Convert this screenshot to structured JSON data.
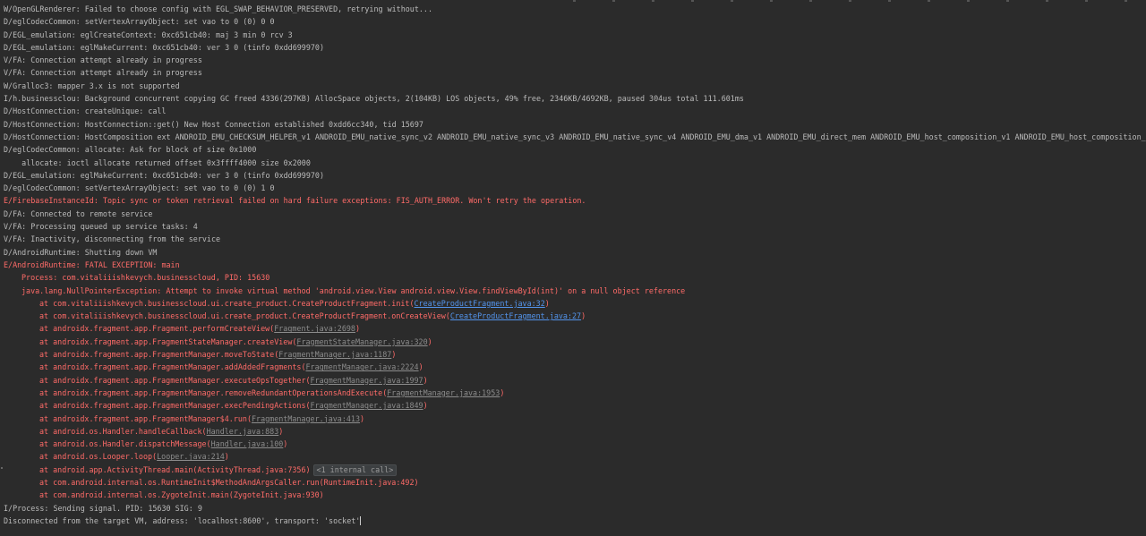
{
  "log": {
    "l01": "W/OpenGLRenderer: Failed to choose config with EGL_SWAP_BEHAVIOR_PRESERVED, retrying without...",
    "l02": "D/eglCodecCommon: setVertexArrayObject: set vao to 0 (0) 0 0",
    "l03": "D/EGL_emulation: eglCreateContext: 0xc651cb40: maj 3 min 0 rcv 3",
    "l04": "D/EGL_emulation: eglMakeCurrent: 0xc651cb40: ver 3 0 (tinfo 0xdd699970)",
    "l05": "V/FA: Connection attempt already in progress",
    "l06": "V/FA: Connection attempt already in progress",
    "l07": "W/Gralloc3: mapper 3.x is not supported",
    "l08": "I/h.businessclou: Background concurrent copying GC freed 4336(297KB) AllocSpace objects, 2(104KB) LOS objects, 49% free, 2346KB/4692KB, paused 304us total 111.601ms",
    "l09": "D/HostConnection: createUnique: call",
    "l10": "D/HostConnection: HostConnection::get() New Host Connection established 0xdd6cc340, tid 15697",
    "l11": "D/HostConnection: HostComposition ext ANDROID_EMU_CHECKSUM_HELPER_v1 ANDROID_EMU_native_sync_v2 ANDROID_EMU_native_sync_v3 ANDROID_EMU_native_sync_v4 ANDROID_EMU_dma_v1 ANDROID_EMU_direct_mem ANDROID_EMU_host_composition_v1 ANDROID_EMU_host_composition_v2",
    "l12": "D/eglCodecCommon: allocate: Ask for block of size 0x1000",
    "l13": "    allocate: ioctl allocate returned offset 0x3ffff4000 size 0x2000",
    "l14": "D/EGL_emulation: eglMakeCurrent: 0xc651cb40: ver 3 0 (tinfo 0xdd699970)",
    "l15": "D/eglCodecCommon: setVertexArrayObject: set vao to 0 (0) 1 0",
    "l16": "E/FirebaseInstanceId: Topic sync or token retrieval failed on hard failure exceptions: FIS_AUTH_ERROR. Won't retry the operation.",
    "l17": "D/FA: Connected to remote service",
    "l18": "V/FA: Processing queued up service tasks: 4",
    "l19": "V/FA: Inactivity, disconnecting from the service",
    "l20": "D/AndroidRuntime: Shutting down VM",
    "l21": "E/AndroidRuntime: FATAL EXCEPTION: main",
    "l22": "Process: com.vitaliiishkevych.businesscloud, PID: 15630",
    "l23": "java.lang.NullPointerException: Attempt to invoke virtual method 'android.view.View android.view.View.findViewById(int)' on a null object reference"
  },
  "trace": [
    {
      "pre": "at com.vitaliiishkevych.businesscloud.ui.create_product.CreateProductFragment.init(",
      "link": "CreateProductFragment.java:32",
      "kind": "link",
      "post": ")"
    },
    {
      "pre": "at com.vitaliiishkevych.businesscloud.ui.create_product.CreateProductFragment.onCreateView(",
      "link": "CreateProductFragment.java:27",
      "kind": "link",
      "post": ")"
    },
    {
      "pre": "at androidx.fragment.app.Fragment.performCreateView(",
      "link": "Fragment.java:2698",
      "kind": "muted",
      "post": ")"
    },
    {
      "pre": "at androidx.fragment.app.FragmentStateManager.createView(",
      "link": "FragmentStateManager.java:320",
      "kind": "muted",
      "post": ")"
    },
    {
      "pre": "at androidx.fragment.app.FragmentManager.moveToState(",
      "link": "FragmentManager.java:1187",
      "kind": "muted",
      "post": ")"
    },
    {
      "pre": "at androidx.fragment.app.FragmentManager.addAddedFragments(",
      "link": "FragmentManager.java:2224",
      "kind": "muted",
      "post": ")"
    },
    {
      "pre": "at androidx.fragment.app.FragmentManager.executeOpsTogether(",
      "link": "FragmentManager.java:1997",
      "kind": "muted",
      "post": ")"
    },
    {
      "pre": "at androidx.fragment.app.FragmentManager.removeRedundantOperationsAndExecute(",
      "link": "FragmentManager.java:1953",
      "kind": "muted",
      "post": ")"
    },
    {
      "pre": "at androidx.fragment.app.FragmentManager.execPendingActions(",
      "link": "FragmentManager.java:1849",
      "kind": "muted",
      "post": ")"
    },
    {
      "pre": "at androidx.fragment.app.FragmentManager$4.run(",
      "link": "FragmentManager.java:413",
      "kind": "muted",
      "post": ")"
    },
    {
      "pre": "at android.os.Handler.handleCallback(",
      "link": "Handler.java:883",
      "kind": "muted",
      "post": ")"
    },
    {
      "pre": "at android.os.Handler.dispatchMessage(",
      "link": "Handler.java:100",
      "kind": "muted",
      "post": ")"
    },
    {
      "pre": "at android.os.Looper.loop(",
      "link": "Looper.java:214",
      "kind": "muted",
      "post": ")"
    }
  ],
  "trace_tail": {
    "activity_main": "at android.app.ActivityThread.main(ActivityThread.java:7356)",
    "internal_calls": "<1 internal call>",
    "runtime_init": "at com.android.internal.os.RuntimeInit$MethodAndArgsCaller.run(RuntimeInit.java:492)",
    "zygote_init": "at com.android.internal.os.ZygoteInit.main(ZygoteInit.java:930)"
  },
  "footer": {
    "signal": "I/Process: Sending signal. PID: 15630 SIG: 9",
    "disconnected": "Disconnected from the target VM, address: 'localhost:8600', transport: 'socket'"
  },
  "colors": {
    "background": "#2b2b2b",
    "text": "#bbbbbb",
    "error": "#ff6b68",
    "link": "#5394ec"
  }
}
